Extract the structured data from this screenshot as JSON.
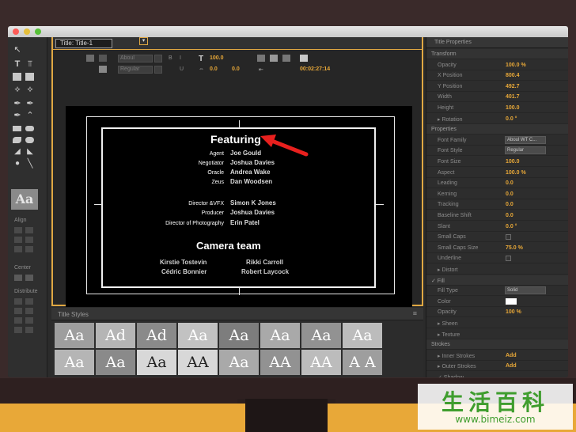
{
  "window": {
    "title_tab": "Title: Title-1"
  },
  "toolbar_left": {
    "align_label": "Align",
    "center_label": "Center",
    "distribute_label": "Distribute",
    "preview_text": "Aa"
  },
  "options_bar": {
    "font_family": "Aboul",
    "font_style": "Regular",
    "size": "100.0",
    "kerning": "0.0",
    "leading": "0.0",
    "timecode": "00:02:27:14"
  },
  "canvas": {
    "heading": "Featuring",
    "cast": [
      {
        "role": "Agent",
        "name": "Joe Gould"
      },
      {
        "role": "Negotiator",
        "name": "Joshua Davies"
      },
      {
        "role": "Oracle",
        "name": "Andrea Wake"
      },
      {
        "role": "Zeus",
        "name": "Dan Woodsen"
      }
    ],
    "crew": [
      {
        "role": "Director &VFX",
        "name": "Simon K Jones"
      },
      {
        "role": "Producer",
        "name": "Joshua Davies"
      },
      {
        "role": "Director of Photography",
        "name": "Erin Patel"
      }
    ],
    "camera_heading": "Camera team",
    "camera_team": [
      {
        "left": "Kirstie Tostevin",
        "right": "Rikki Carroll"
      },
      {
        "left": "Cédric Bonnier",
        "right": "Robert Laycock"
      }
    ],
    "arrow_color": "#e8201e"
  },
  "title_styles": {
    "header": "Title Styles",
    "menu": "≡",
    "swatches_row1": [
      "Aa",
      "Ad",
      "Ad",
      "Aa",
      "Aa",
      "Aa",
      "Aa",
      "Aa"
    ],
    "swatches_row2": [
      "Aa",
      "Aa",
      "Aa",
      "AA",
      "Aa",
      "AA",
      "AA",
      "A A"
    ]
  },
  "properties": {
    "header": "Title Properties",
    "rows": [
      {
        "kind": "section",
        "label": "Transform"
      },
      {
        "kind": "value",
        "label": "Opacity",
        "value": "100.0 %"
      },
      {
        "kind": "value",
        "label": "X Position",
        "value": "800.4"
      },
      {
        "kind": "value",
        "label": "Y Position",
        "value": "492.7"
      },
      {
        "kind": "value",
        "label": "Width",
        "value": "401.7"
      },
      {
        "kind": "value",
        "label": "Height",
        "value": "100.0"
      },
      {
        "kind": "value",
        "label": "▸ Rotation",
        "value": "0.0 °"
      },
      {
        "kind": "section",
        "label": "Properties"
      },
      {
        "kind": "box",
        "label": "Font Family",
        "value": "Aboul WT C..."
      },
      {
        "kind": "box",
        "label": "Font Style",
        "value": "Regular"
      },
      {
        "kind": "value",
        "label": "Font Size",
        "value": "100.0"
      },
      {
        "kind": "value",
        "label": "Aspect",
        "value": "100.0 %"
      },
      {
        "kind": "value",
        "label": "Leading",
        "value": "0.0"
      },
      {
        "kind": "value",
        "label": "Kerning",
        "value": "0.0"
      },
      {
        "kind": "value",
        "label": "Tracking",
        "value": "0.0"
      },
      {
        "kind": "value",
        "label": "Baseline Shift",
        "value": "0.0"
      },
      {
        "kind": "value",
        "label": "Slant",
        "value": "0.0 °"
      },
      {
        "kind": "check",
        "label": "Small Caps",
        "value": ""
      },
      {
        "kind": "value",
        "label": "Small Caps Size",
        "value": "75.0 %"
      },
      {
        "kind": "check",
        "label": "Underline",
        "value": ""
      },
      {
        "kind": "value",
        "label": "▸ Distort",
        "value": ""
      },
      {
        "kind": "section",
        "label": "✓ Fill"
      },
      {
        "kind": "box",
        "label": "Fill Type",
        "value": "Solid"
      },
      {
        "kind": "swatch",
        "label": "Color",
        "value": ""
      },
      {
        "kind": "value",
        "label": "Opacity",
        "value": "100 %"
      },
      {
        "kind": "value",
        "label": "▸ Sheen",
        "value": ""
      },
      {
        "kind": "value",
        "label": "▸ Texture",
        "value": ""
      },
      {
        "kind": "section",
        "label": "Strokes"
      },
      {
        "kind": "value",
        "label": "▸ Inner Strokes",
        "value": "Add"
      },
      {
        "kind": "value",
        "label": "▸ Outer Strokes",
        "value": "Add"
      },
      {
        "kind": "value",
        "label": "✓ Shadow",
        "value": ""
      }
    ]
  },
  "watermark": {
    "chinese": "生活百科",
    "url": "www.bimeiz.com"
  }
}
